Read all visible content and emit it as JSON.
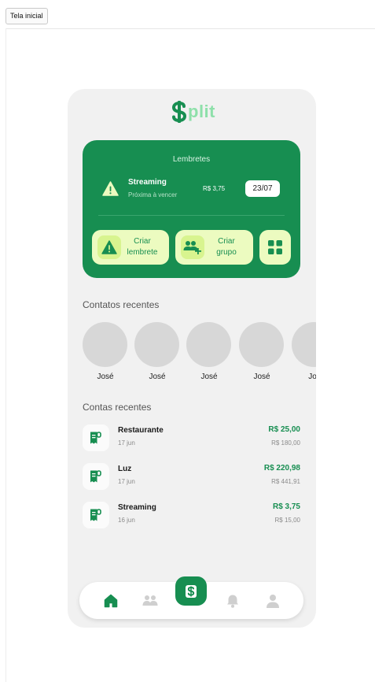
{
  "window": {
    "tab_title": "Tela inicial"
  },
  "app": {
    "logo_text": "plit",
    "brand_color": "#178e51",
    "accent_color": "#ecfbc0"
  },
  "reminders": {
    "title": "Lembretes",
    "item": {
      "name": "Streaming",
      "status": "Próxima à vencer",
      "amount": "R$ 3,75",
      "date": "23/07",
      "icon": "warning-icon"
    },
    "actions": [
      {
        "label_line1": "Criar",
        "label_line2": "lembrete",
        "icon": "warning-icon"
      },
      {
        "label_line1": "Criar",
        "label_line2": "grupo",
        "icon": "group-add-icon"
      },
      {
        "label": "",
        "icon": "grid-icon"
      }
    ]
  },
  "contacts": {
    "title": "Contatos recentes",
    "items": [
      {
        "name": "José"
      },
      {
        "name": "José"
      },
      {
        "name": "José"
      },
      {
        "name": "José"
      },
      {
        "name": "Jos"
      }
    ]
  },
  "bills": {
    "title": "Contas recentes",
    "items": [
      {
        "name": "Restaurante",
        "date": "17 jun",
        "amount": "R$ 25,00",
        "total": "R$ 180,00",
        "icon": "receipt-icon"
      },
      {
        "name": "Luz",
        "date": "17 jun",
        "amount": "R$ 220,98",
        "total": "R$ 441,91",
        "icon": "receipt-icon"
      },
      {
        "name": "Streaming",
        "date": "16 jun",
        "amount": "R$ 3,75",
        "total": "R$ 15,00",
        "icon": "receipt-icon"
      }
    ]
  },
  "navbar": {
    "items": [
      {
        "icon": "home-icon",
        "active": true
      },
      {
        "icon": "groups-icon",
        "active": false
      },
      {
        "icon": "split-icon",
        "active": false
      },
      {
        "icon": "bell-icon",
        "active": false
      },
      {
        "icon": "profile-icon",
        "active": false
      }
    ]
  }
}
